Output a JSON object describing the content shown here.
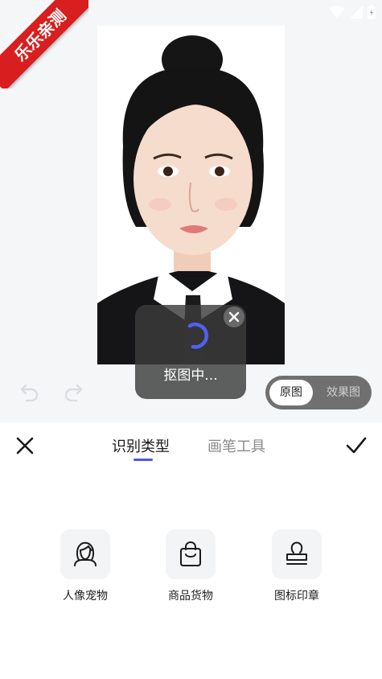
{
  "ribbon": {
    "text": "乐乐亲测"
  },
  "toast": {
    "text": "抠图中..."
  },
  "toggle": {
    "original": "原图",
    "effect": "效果图"
  },
  "tabs": [
    {
      "label": "识别类型",
      "active": true
    },
    {
      "label": "画笔工具",
      "active": false
    }
  ],
  "options": [
    {
      "label": "人像宠物",
      "icon": "portrait-icon"
    },
    {
      "label": "商品货物",
      "icon": "shopping-bag-icon"
    },
    {
      "label": "图标印章",
      "icon": "stamp-icon"
    }
  ],
  "colors": {
    "accent": "#4a56e2",
    "ribbon": "#d81e1e",
    "canvas_bg": "#f5f6f8"
  }
}
